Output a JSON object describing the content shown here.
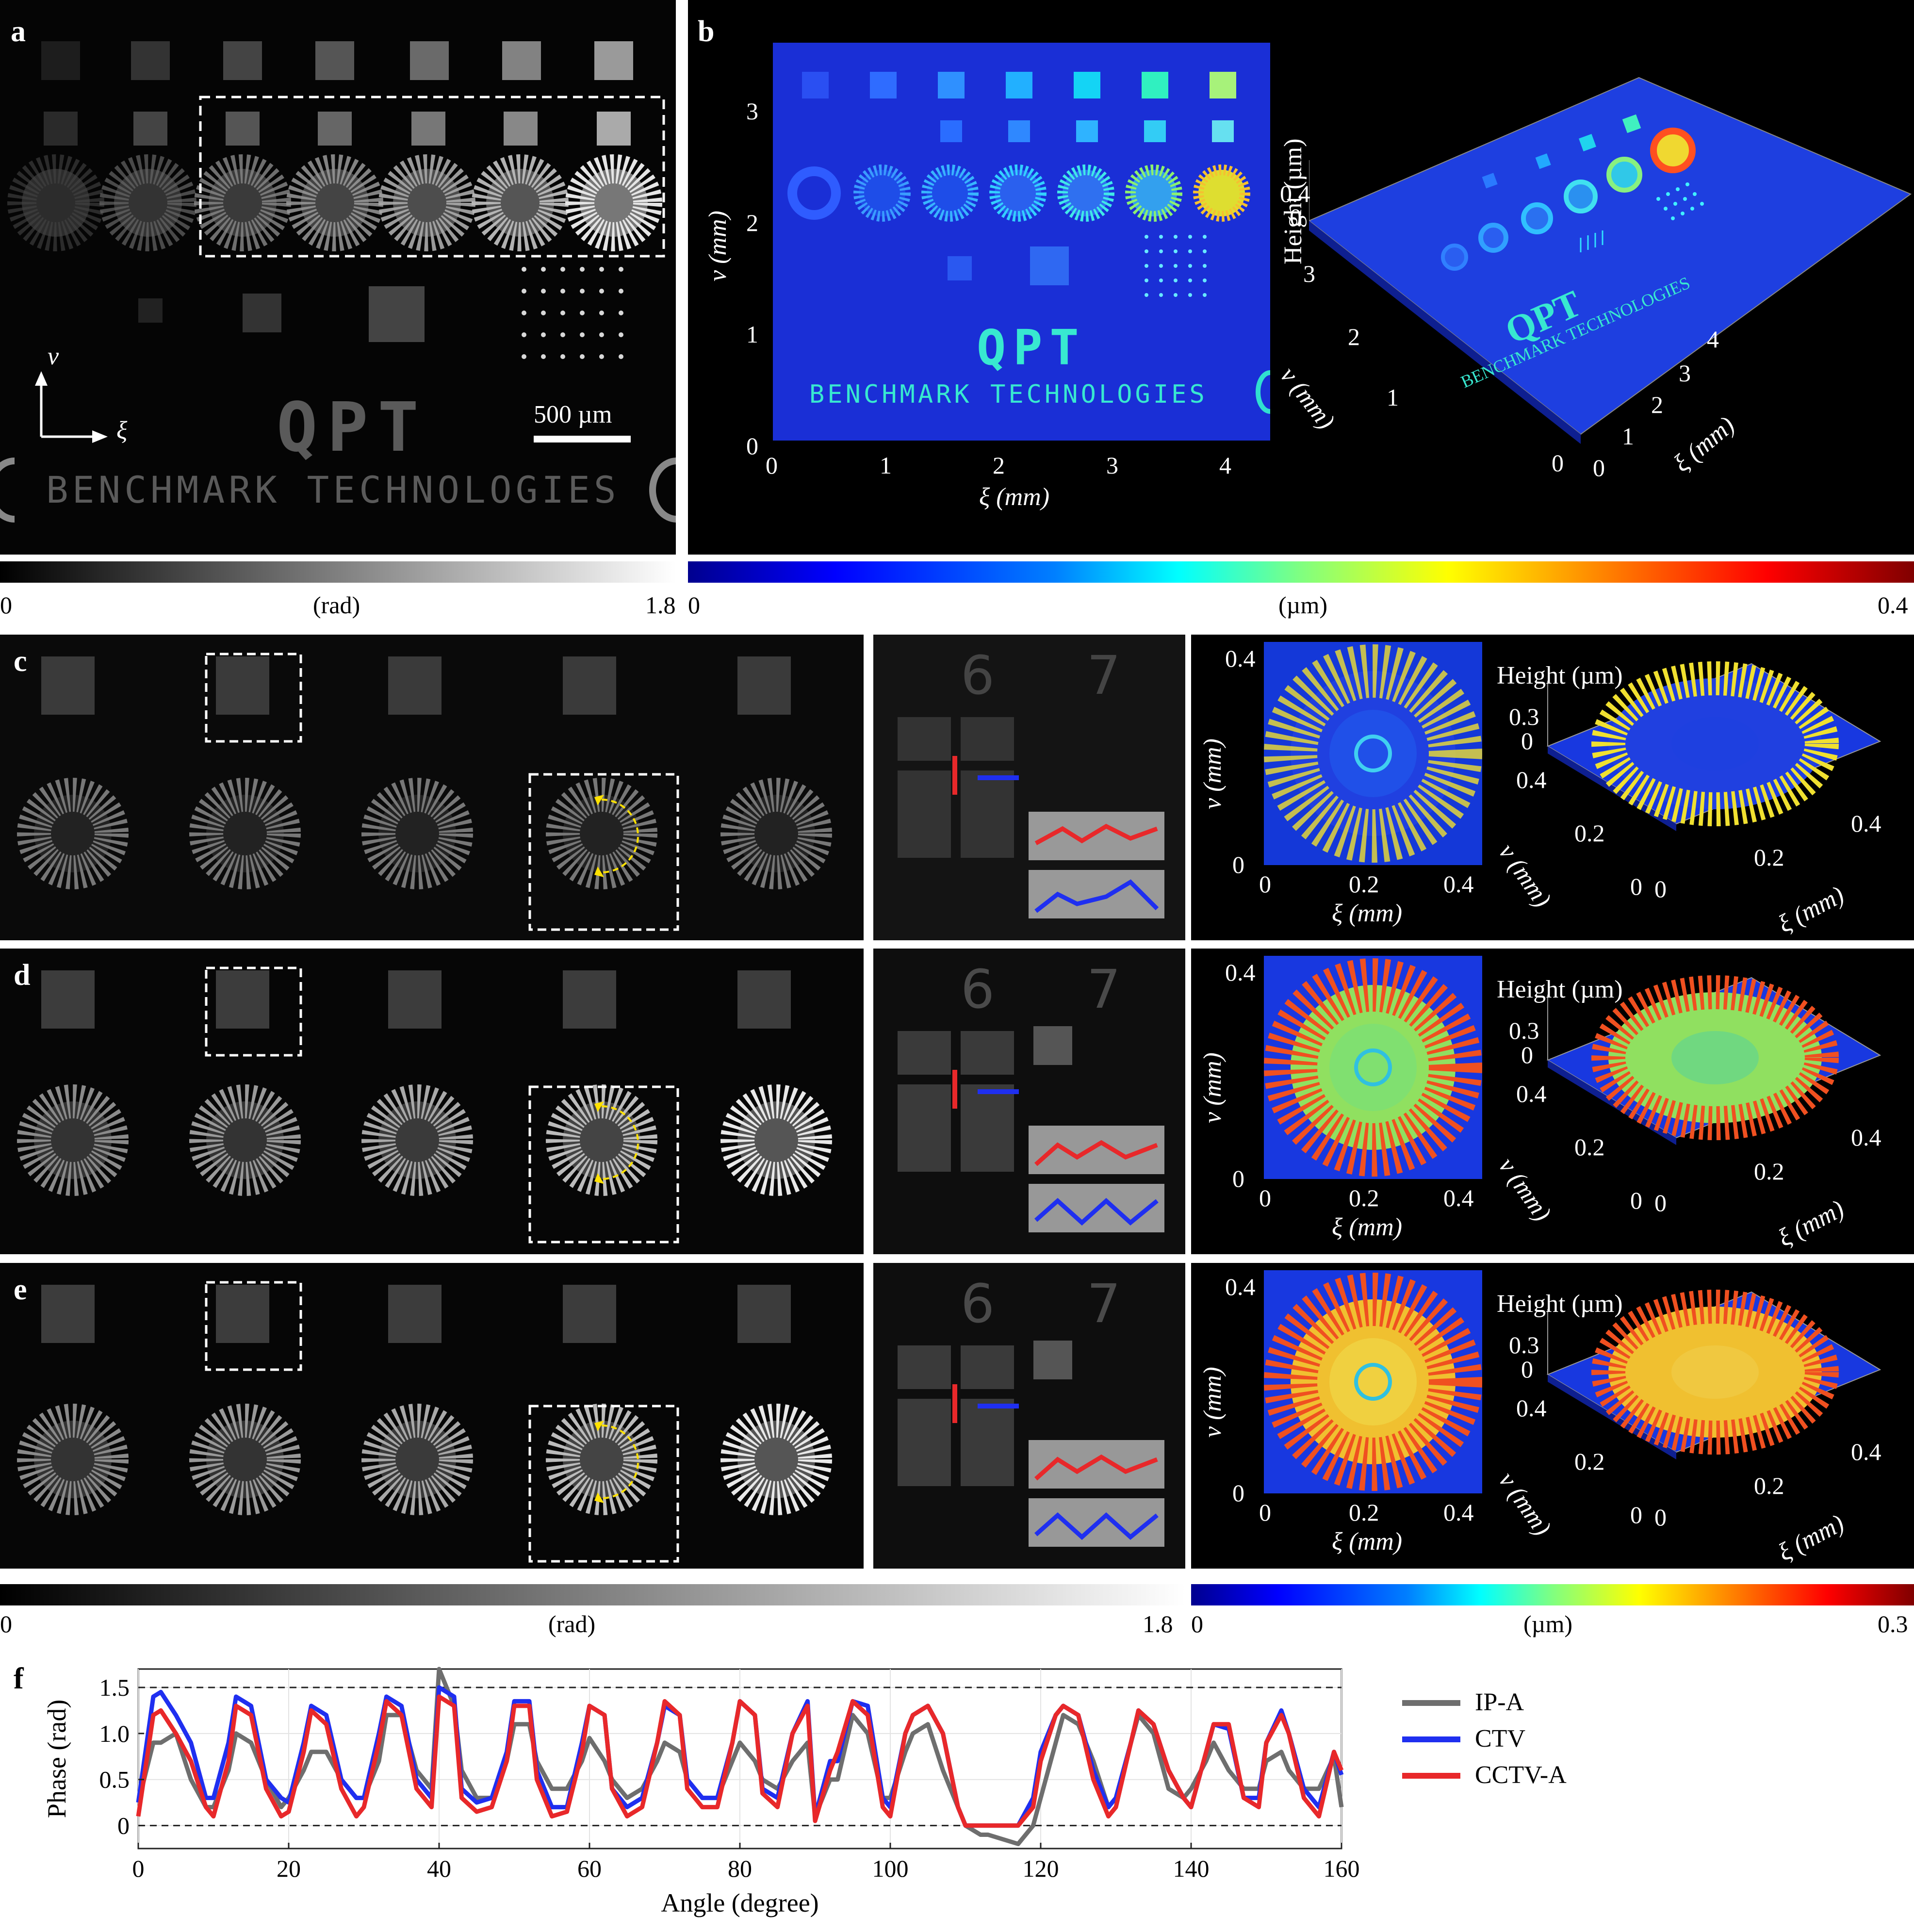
{
  "panels": {
    "a": {
      "label": "a",
      "axis_v": "v",
      "axis_xi": "ξ",
      "scale_bar": "500 µm",
      "logo": "QPT",
      "brand": "BENCHMARK TECHNOLOGIES"
    },
    "b": {
      "label": "b",
      "y_label": "v (mm)",
      "x_label": "ξ (mm)",
      "y_ticks": [
        "3",
        "2",
        "1",
        "0"
      ],
      "x_ticks": [
        "0",
        "1",
        "2",
        "3",
        "4"
      ],
      "logo": "QPT",
      "brand": "BENCHMARK TECHNOLOGIES",
      "height_label": "Height (µm)",
      "height_ticks": [
        "0.4",
        "0"
      ],
      "v3d_label": "v (mm)",
      "xi3d_label": "ξ (mm)",
      "v3d_ticks": [
        "3",
        "2",
        "1",
        "0"
      ],
      "xi3d_ticks": [
        "0",
        "1",
        "2",
        "3",
        "4"
      ]
    },
    "c": {
      "label": "c",
      "inset_digits": [
        "6",
        "7"
      ]
    },
    "d": {
      "label": "d",
      "inset_digits": [
        "6",
        "7"
      ]
    },
    "e": {
      "label": "e",
      "inset_digits": [
        "6",
        "7"
      ]
    },
    "f": {
      "label": "f"
    }
  },
  "zoom_3d": {
    "y_label": "v (mm)",
    "x_label": "ξ (mm)",
    "y_ticks": [
      "0.4",
      "0"
    ],
    "x_ticks": [
      "0",
      "0.2",
      "0.4"
    ],
    "height_label": "Height (µm)",
    "height_ticks": [
      "0.3",
      "0"
    ],
    "v3d_label": "v (mm)",
    "xi3d_label": "ξ (mm)",
    "v3d_ticks": [
      "0.4",
      "0.2",
      "0"
    ],
    "xi3d_ticks": [
      "0",
      "0.2",
      "0.4"
    ]
  },
  "colorbars": {
    "top_gray": {
      "min": "0",
      "unit": "(rad)",
      "max": "1.8"
    },
    "top_jet": {
      "min": "0",
      "unit": "(µm)",
      "max": "0.4"
    },
    "bottom_gray": {
      "min": "0",
      "unit": "(rad)",
      "max": "1.8"
    },
    "bottom_jet": {
      "min": "0",
      "unit": "(µm)",
      "max": "0.3"
    }
  },
  "colors": {
    "ipa": "#6e6e6e",
    "ctv": "#1f2ff0",
    "cctva": "#e8282a",
    "dashed_box": "#ffffff",
    "arrow": "#ffe100"
  },
  "chart_data": {
    "type": "line",
    "xlabel": "Angle (degree)",
    "ylabel": "Phase (rad)",
    "xlim": [
      0,
      160
    ],
    "ylim": [
      -0.25,
      1.7
    ],
    "x_ticks": [
      0,
      20,
      40,
      60,
      80,
      100,
      120,
      140,
      160
    ],
    "y_ticks": [
      0,
      0.5,
      1.0,
      1.5
    ],
    "y_tick_labels": [
      "0",
      "0.5",
      "1.0",
      "1.5"
    ],
    "reference_lines": [
      0,
      1.5
    ],
    "grid": true,
    "legend_position": "right",
    "x": [
      0,
      2,
      3,
      5,
      7,
      9,
      10,
      12,
      13,
      15,
      17,
      19,
      20,
      22,
      23,
      25,
      27,
      29,
      30,
      32,
      33,
      35,
      37,
      39,
      40,
      42,
      43,
      45,
      47,
      49,
      50,
      52,
      53,
      55,
      57,
      59,
      60,
      62,
      63,
      65,
      67,
      69,
      70,
      72,
      73,
      75,
      77,
      79,
      80,
      82,
      83,
      85,
      87,
      89,
      90,
      92,
      93,
      95,
      97,
      99,
      100,
      102,
      103,
      105,
      107,
      109,
      110,
      112,
      113,
      115,
      117,
      119,
      120,
      122,
      123,
      125,
      127,
      129,
      130,
      132,
      133,
      135,
      137,
      139,
      140,
      142,
      143,
      145,
      147,
      149,
      150,
      152,
      153,
      155,
      157,
      159,
      160
    ],
    "series": [
      {
        "name": "IP-A",
        "color": "#6e6e6e",
        "values": [
          0.25,
          0.9,
          0.9,
          1.0,
          0.5,
          0.2,
          0.2,
          0.6,
          1.0,
          0.9,
          0.5,
          0.2,
          0.3,
          0.6,
          0.8,
          0.8,
          0.5,
          0.3,
          0.3,
          0.7,
          1.2,
          1.2,
          0.6,
          0.4,
          1.7,
          1.3,
          0.6,
          0.3,
          0.3,
          0.7,
          1.1,
          1.1,
          0.7,
          0.4,
          0.4,
          0.7,
          0.95,
          0.7,
          0.5,
          0.3,
          0.4,
          0.7,
          0.9,
          0.8,
          0.5,
          0.3,
          0.3,
          0.7,
          0.9,
          0.7,
          0.5,
          0.4,
          0.7,
          0.9,
          0.1,
          0.5,
          0.5,
          1.2,
          1.0,
          0.3,
          0.3,
          0.8,
          1.0,
          1.1,
          0.6,
          0.2,
          0.0,
          -0.1,
          -0.1,
          -0.15,
          -0.2,
          0.0,
          0.3,
          0.9,
          1.2,
          1.1,
          0.7,
          0.2,
          0.3,
          0.9,
          1.2,
          1.0,
          0.4,
          0.3,
          0.4,
          0.7,
          0.9,
          0.6,
          0.4,
          0.4,
          0.7,
          0.8,
          0.6,
          0.4,
          0.4,
          0.75,
          0.2
        ]
      },
      {
        "name": "CTV",
        "color": "#1f2ff0",
        "values": [
          0.25,
          1.4,
          1.45,
          1.2,
          0.9,
          0.3,
          0.3,
          0.9,
          1.4,
          1.3,
          0.5,
          0.3,
          0.25,
          0.9,
          1.3,
          1.2,
          0.5,
          0.3,
          0.3,
          1.0,
          1.4,
          1.3,
          0.5,
          0.3,
          1.5,
          1.4,
          0.4,
          0.25,
          0.3,
          0.8,
          1.35,
          1.35,
          0.6,
          0.2,
          0.2,
          0.9,
          1.3,
          1.2,
          0.4,
          0.2,
          0.3,
          0.9,
          1.3,
          1.2,
          0.5,
          0.3,
          0.3,
          0.9,
          1.35,
          1.2,
          0.4,
          0.3,
          1.0,
          1.35,
          0.1,
          0.7,
          0.7,
          1.35,
          1.3,
          0.3,
          0.2,
          1.0,
          1.2,
          1.3,
          1.0,
          0.2,
          0.0,
          0.0,
          0.0,
          0.0,
          0.0,
          0.3,
          0.8,
          1.2,
          1.3,
          1.2,
          0.6,
          0.2,
          0.3,
          0.9,
          1.25,
          1.1,
          0.6,
          0.3,
          0.2,
          0.8,
          1.1,
          1.05,
          0.3,
          0.3,
          0.9,
          1.25,
          1.0,
          0.4,
          0.2,
          0.8,
          0.55
        ]
      },
      {
        "name": "CCTV-A",
        "color": "#e8282a",
        "values": [
          0.1,
          1.2,
          1.25,
          1.0,
          0.7,
          0.2,
          0.1,
          0.7,
          1.3,
          1.2,
          0.4,
          0.1,
          0.15,
          0.8,
          1.25,
          1.1,
          0.4,
          0.1,
          0.2,
          0.9,
          1.35,
          1.2,
          0.4,
          0.2,
          1.4,
          1.3,
          0.3,
          0.15,
          0.2,
          0.7,
          1.3,
          1.3,
          0.5,
          0.1,
          0.15,
          0.8,
          1.3,
          1.2,
          0.4,
          0.1,
          0.2,
          0.9,
          1.35,
          1.2,
          0.4,
          0.2,
          0.2,
          0.9,
          1.35,
          1.2,
          0.35,
          0.2,
          1.0,
          1.3,
          0.05,
          0.6,
          0.8,
          1.35,
          1.2,
          0.2,
          0.1,
          1.0,
          1.2,
          1.3,
          1.0,
          0.2,
          0.0,
          0.0,
          0.0,
          0.0,
          0.0,
          0.2,
          0.7,
          1.2,
          1.3,
          1.2,
          0.5,
          0.1,
          0.2,
          0.9,
          1.25,
          1.1,
          0.6,
          0.3,
          0.2,
          0.8,
          1.1,
          1.1,
          0.3,
          0.2,
          0.9,
          1.2,
          1.0,
          0.3,
          0.1,
          0.8,
          0.6
        ]
      }
    ]
  }
}
